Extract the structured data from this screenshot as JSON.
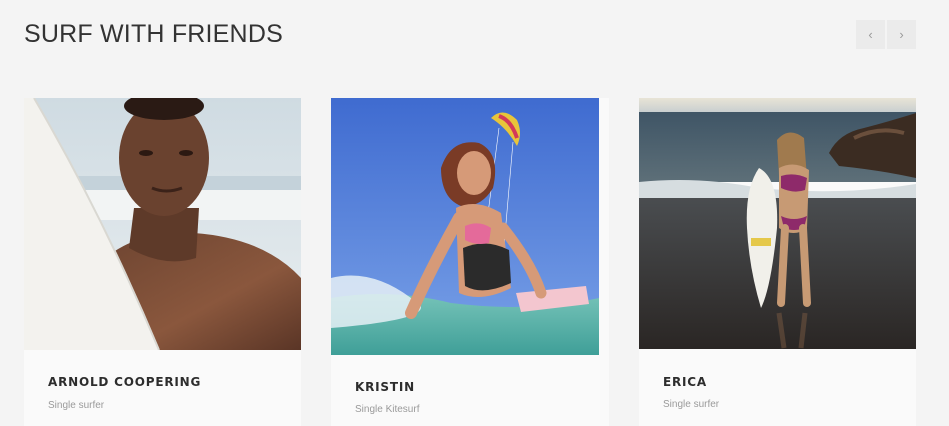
{
  "section": {
    "title": "SURF WITH FRIENDS"
  },
  "nav": {
    "prev_icon": "chevron-left-icon",
    "next_icon": "chevron-right-icon",
    "prev_glyph": "‹",
    "next_glyph": "›"
  },
  "cards": [
    {
      "name": "ARNOLD COOPERING",
      "role": "Single surfer"
    },
    {
      "name": "KRISTIN",
      "role": "Single Kitesurf"
    },
    {
      "name": "ERICA",
      "role": "Single surfer"
    }
  ],
  "colors": {
    "background": "#f4f4f4",
    "card": "#fafafa",
    "title": "#333333",
    "muted": "#9a9a9a"
  }
}
